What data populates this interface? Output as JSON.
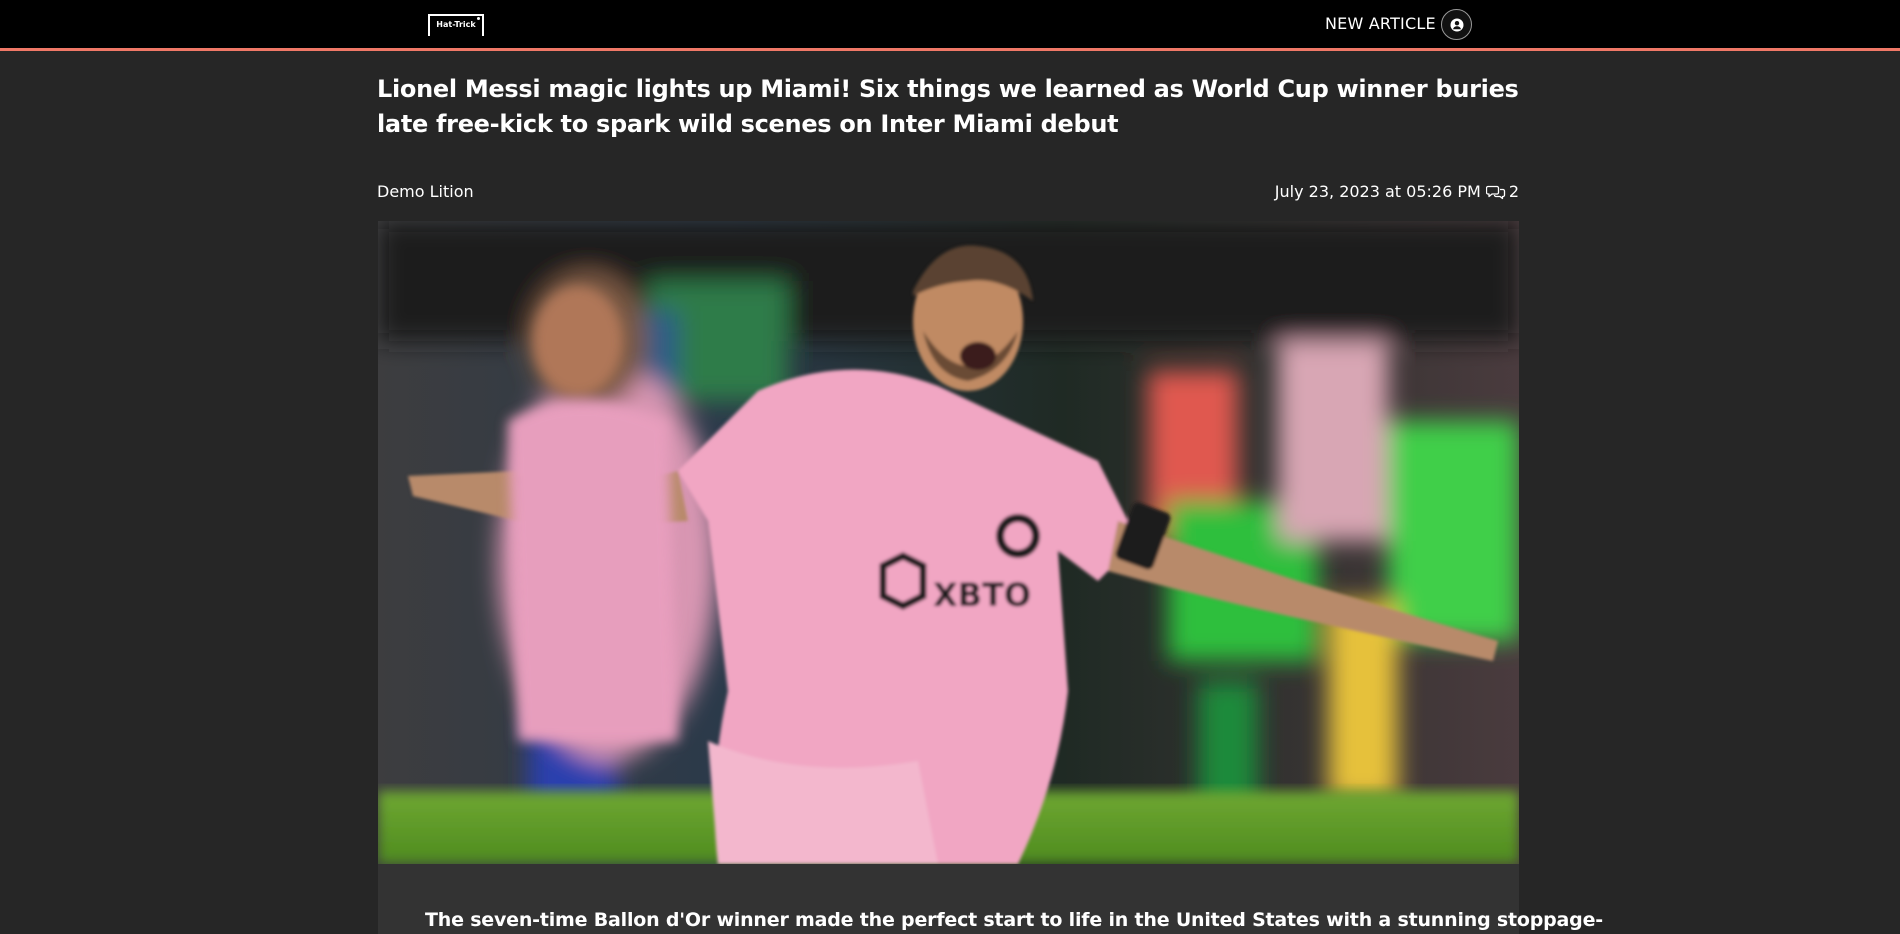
{
  "header": {
    "logo_text": "Hat-Trick",
    "new_article_label": "NEW ARTICLE",
    "accent_color": "#f07867"
  },
  "article": {
    "title": "Lionel Messi magic lights up Miami! Six things we learned as World Cup winner buries late free-kick to spark wild scenes on Inter Miami debut",
    "author": "Demo Lition",
    "date": "July 23, 2023 at 05:26 PM",
    "comment_count": "2",
    "hero_image_description_icon": "photo",
    "summary": "The seven-time Ballon d'Or winner made the perfect start to life in the United States with a stunning stoppage-"
  },
  "icons": {
    "user": "user-circle-icon",
    "comments": "comments-icon"
  }
}
